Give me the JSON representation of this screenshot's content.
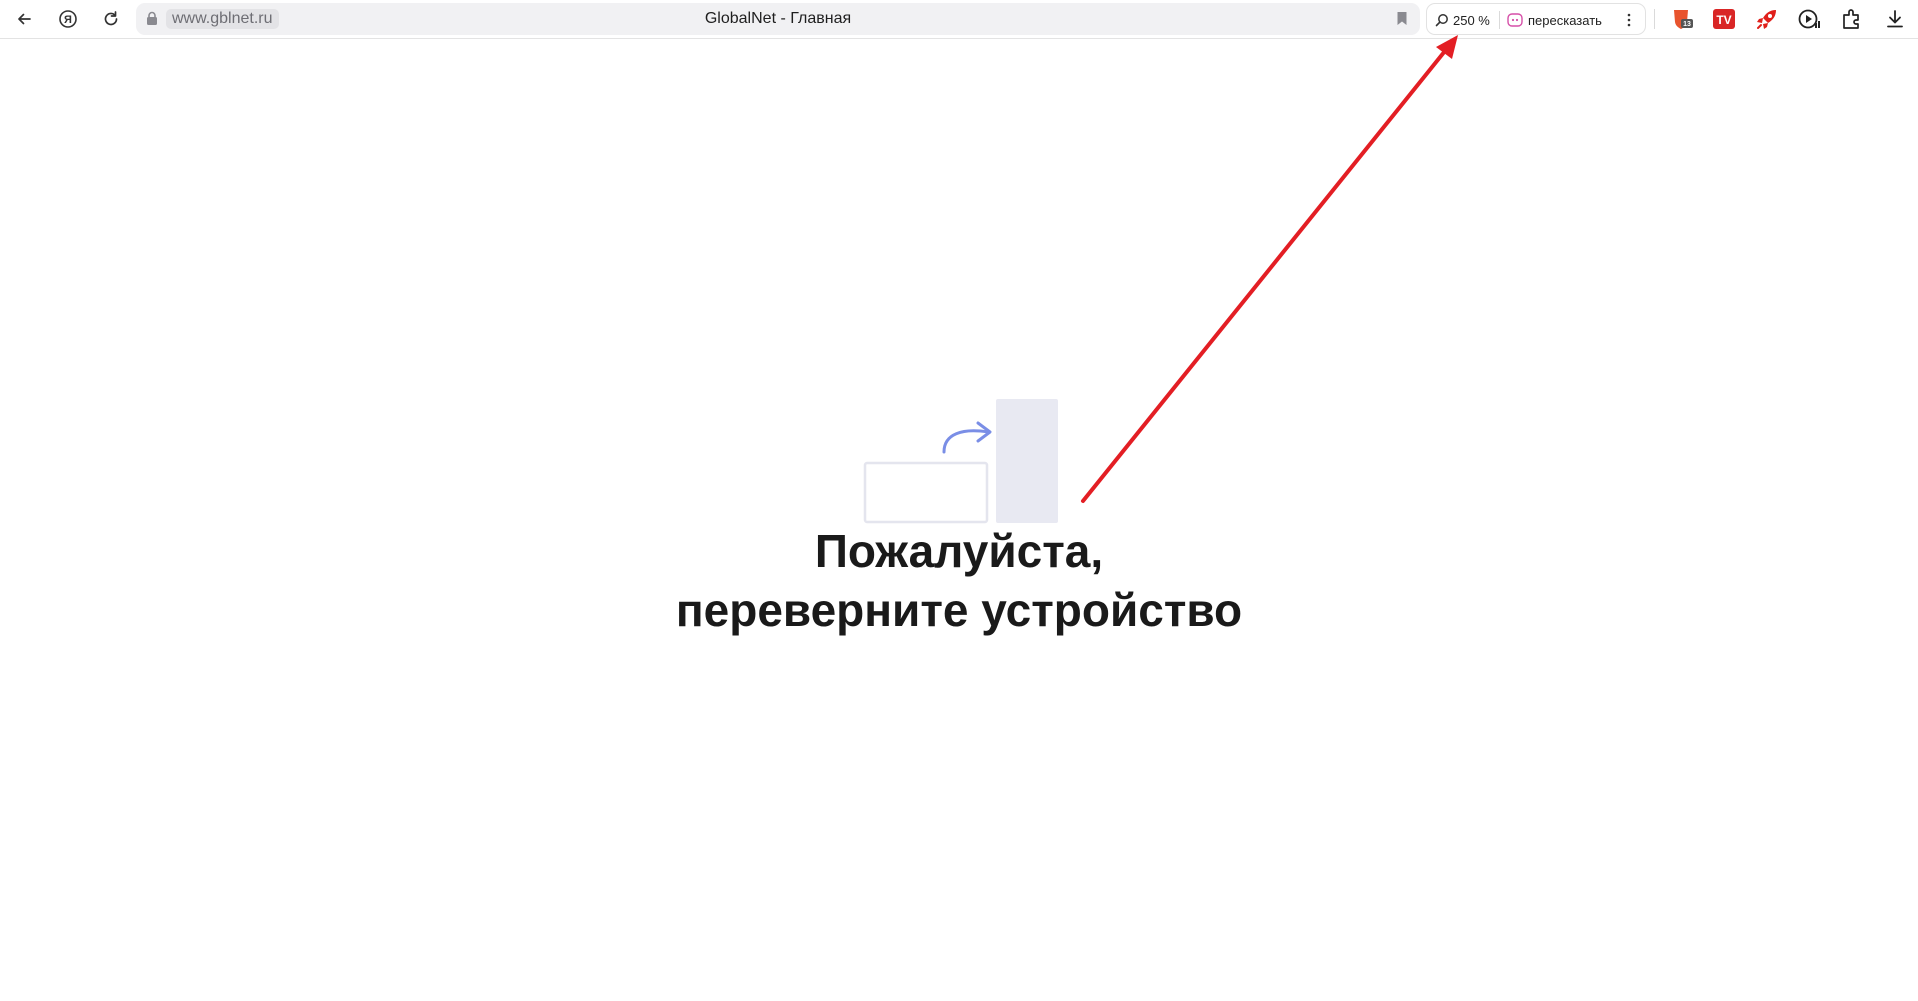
{
  "browser": {
    "address_bar": {
      "url": "www.gblnet.ru"
    },
    "page_title": "GlobalNet - Главная",
    "zoom": {
      "label": "250 %"
    },
    "retell": {
      "label": "пересказать"
    },
    "toolbar_icons": [
      "back-icon",
      "yandex-icon",
      "reload-icon",
      "lock-icon",
      "bookmark-icon",
      "zoom-icon",
      "retell-icon",
      "menu-icon"
    ],
    "extensions": [
      {
        "name": "shield-extension-icon",
        "badge": "13",
        "color": "#e8542e"
      },
      {
        "name": "tv-extension-icon",
        "text": "TV",
        "color": "#d92626"
      },
      {
        "name": "rocket-extension-icon",
        "color": "#e0201b"
      },
      {
        "name": "play-extension-icon"
      },
      {
        "name": "extensions-icon"
      },
      {
        "name": "download-icon"
      }
    ]
  },
  "page": {
    "headline_line1": "Пожалуйста,",
    "headline_line2": "переверните устройство",
    "illustration": "rotate-device-illustration"
  },
  "annotation": {
    "type": "arrow",
    "color": "#e31e24"
  },
  "colors": {
    "accent_blue": "#7a8ee6",
    "device_fill": "#e8e9f2",
    "arrow": "#e31e24"
  }
}
